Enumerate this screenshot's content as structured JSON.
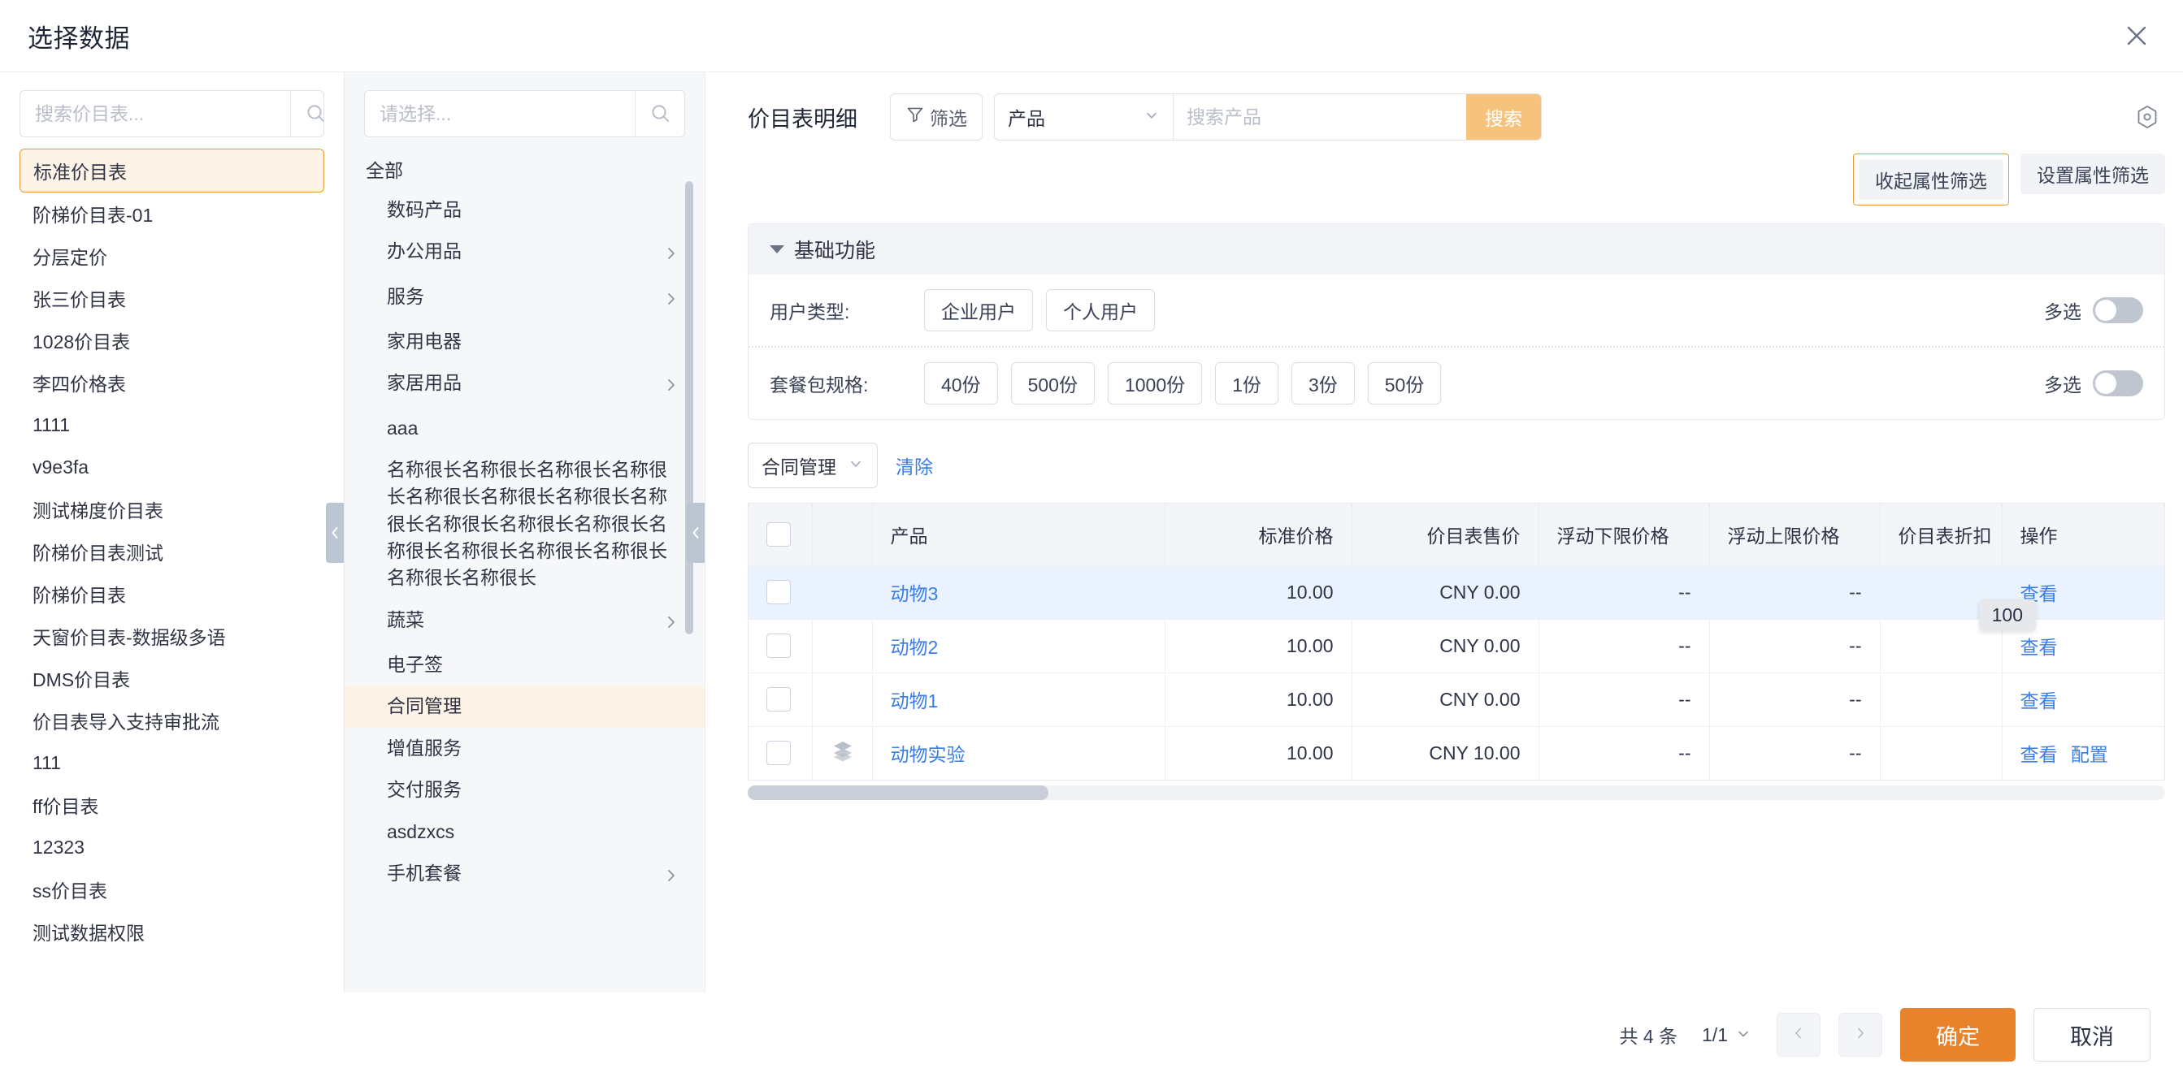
{
  "dialog": {
    "title": "选择数据",
    "close_icon": "close-icon"
  },
  "price_lists": {
    "search_placeholder": "搜索价目表...",
    "search_icon": "search-icon",
    "selected": "标准价目表",
    "items": [
      "标准价目表",
      "阶梯价目表-01",
      "分层定价",
      "张三价目表",
      "1028价目表",
      "李四价格表",
      "1111",
      "v9e3fa",
      "测试梯度价目表",
      "阶梯价目表测试",
      "阶梯价目表",
      "天窗价目表-数据级多语",
      "DMS价目表",
      "价目表导入支持审批流",
      "111",
      "ff价目表",
      "12323",
      "ss价目表",
      "测试数据权限"
    ]
  },
  "tree": {
    "search_placeholder": "请选择...",
    "search_icon": "search-icon",
    "root": "全部",
    "highlighted": "合同管理",
    "nodes": [
      {
        "label": "数码产品",
        "expandable": false
      },
      {
        "label": "办公用品",
        "expandable": true
      },
      {
        "label": "服务",
        "expandable": true
      },
      {
        "label": "家用电器",
        "expandable": false
      },
      {
        "label": "家居用品",
        "expandable": true
      },
      {
        "label": "aaa",
        "expandable": false
      },
      {
        "label": "名称很长名称很长名称很长名称很长名称很长名称很长名称很长名称很长名称很长名称很长名称很长名称很长名称很长名称很长名称很长名称很长名称很长",
        "expandable": false
      },
      {
        "label": "蔬菜",
        "expandable": true
      },
      {
        "label": "电子签",
        "expandable": false
      },
      {
        "label": "合同管理",
        "expandable": false
      },
      {
        "label": "增值服务",
        "expandable": false
      },
      {
        "label": "交付服务",
        "expandable": false
      },
      {
        "label": "asdzxcs",
        "expandable": false
      },
      {
        "label": "手机套餐",
        "expandable": true
      }
    ]
  },
  "detail": {
    "title": "价目表明细",
    "filter_button": "筛选",
    "filter_icon": "funnel-icon",
    "search_select_value": "产品",
    "search_placeholder": "搜索产品",
    "search_button": "搜索",
    "gear_icon": "target-icon",
    "collapse_attr_button": "收起属性筛选",
    "setting_attr_button": "设置属性筛选"
  },
  "filter_panel": {
    "section_title": "基础功能",
    "rows": [
      {
        "label": "用户类型:",
        "options": [
          "企业用户",
          "个人用户"
        ],
        "multi_label": "多选",
        "multi_on": false
      },
      {
        "label": "套餐包规格:",
        "options": [
          "40份",
          "500份",
          "1000份",
          "1份",
          "3份",
          "50份"
        ],
        "multi_label": "多选",
        "multi_on": false
      }
    ]
  },
  "tagbar": {
    "selected_tag": "合同管理",
    "clear_label": "清除",
    "chevron_icon": "chevron-down-icon"
  },
  "table": {
    "columns": [
      "",
      "",
      "产品",
      "标准价格",
      "价目表售价",
      "浮动下限价格",
      "浮动上限价格",
      "价目表折扣",
      "操作"
    ],
    "tooltip": "100",
    "rows": [
      {
        "checked": false,
        "icon": "",
        "product": "动物3",
        "standard_price": "10.00",
        "list_price": "CNY 0.00",
        "float_lower": "--",
        "float_upper": "--",
        "discount": "",
        "actions": [
          "查看"
        ],
        "highlighted": true
      },
      {
        "checked": false,
        "icon": "",
        "product": "动物2",
        "standard_price": "10.00",
        "list_price": "CNY 0.00",
        "float_lower": "--",
        "float_upper": "--",
        "discount": "",
        "actions": [
          "查看"
        ],
        "highlighted": false
      },
      {
        "checked": false,
        "icon": "",
        "product": "动物1",
        "standard_price": "10.00",
        "list_price": "CNY 0.00",
        "float_lower": "--",
        "float_upper": "--",
        "discount": "",
        "actions": [
          "查看"
        ],
        "highlighted": false
      },
      {
        "checked": false,
        "icon": "layers-icon",
        "product": "动物实验",
        "standard_price": "10.00",
        "list_price": "CNY 10.00",
        "float_lower": "--",
        "float_upper": "--",
        "discount": "",
        "actions": [
          "查看",
          "配置"
        ],
        "highlighted": false
      }
    ]
  },
  "footer": {
    "total": "共 4 条",
    "page_indicator": "1/1",
    "prev_icon": "chevron-left-icon",
    "next_icon": "chevron-right-icon",
    "confirm": "确定",
    "cancel": "取消"
  },
  "colors": {
    "accent": "#e8832b",
    "link": "#3a7de8",
    "highlight_bg": "#fdf3e6",
    "row_highlight": "#eaf2fd"
  }
}
